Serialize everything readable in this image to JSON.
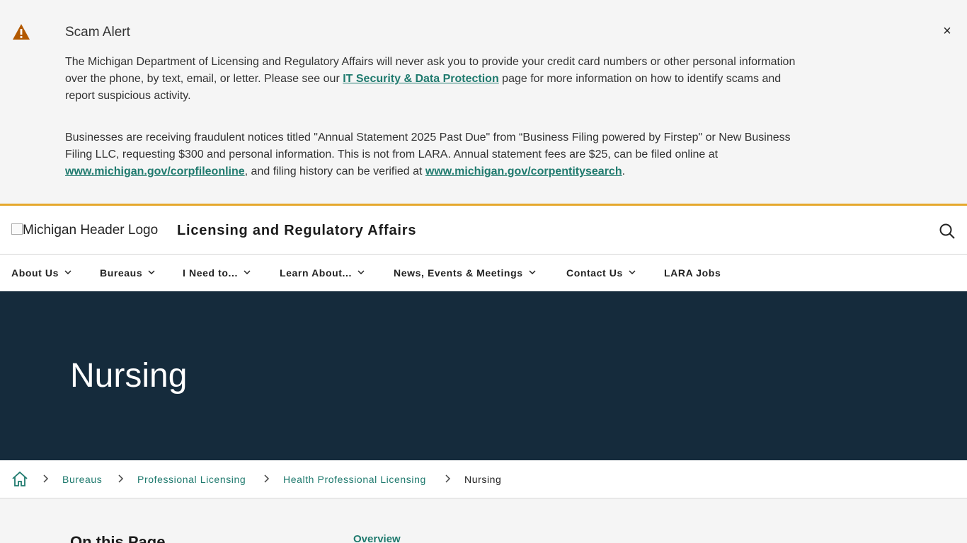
{
  "alert": {
    "title": "Scam Alert",
    "close_label": "×",
    "p1_before": "The Michigan Department of Licensing and Regulatory Affairs will never ask you to provide your credit card numbers or other personal information over the phone, by text, email, or letter. Please see our ",
    "p1_link": "IT Security & Data Protection",
    "p1_after": " page for more information on how to identify scams and report suspicious activity.",
    "p2_before": "Businesses are receiving fraudulent notices titled \"Annual Statement 2025 Past Due\" from “Business Filing powered by Firstep\" or New Business Filing LLC, requesting $300 and personal information. This is not from LARA. Annual statement fees are $25, can be filed online at ",
    "p2_link1": "www.michigan.gov/corpfileonline",
    "p2_mid": ", and filing history can be verified at ",
    "p2_link2": "www.michigan.gov/corpentitysearch",
    "p2_after": "."
  },
  "header": {
    "logo_alt": "Michigan Header Logo",
    "site_title": "Licensing and Regulatory Affairs"
  },
  "nav": {
    "items": [
      {
        "label": "About Us"
      },
      {
        "label": "Bureaus"
      },
      {
        "label": "I Need to..."
      },
      {
        "label": "Learn About..."
      },
      {
        "label": "News, Events & Meetings"
      },
      {
        "label": "Contact Us"
      },
      {
        "label": "LARA Jobs"
      }
    ]
  },
  "hero": {
    "title": "Nursing"
  },
  "breadcrumb": {
    "links": [
      "Bureaus",
      "Professional Licensing",
      "Health Professional Licensing"
    ],
    "current": "Nursing"
  },
  "content": {
    "on_this_page": "On this Page",
    "toc_first": "Overview"
  },
  "colors": {
    "accent_gold": "#e5a82c",
    "link_teal": "#1f7a6e",
    "hero_navy": "#152b3c",
    "warning_orange": "#b35900"
  }
}
